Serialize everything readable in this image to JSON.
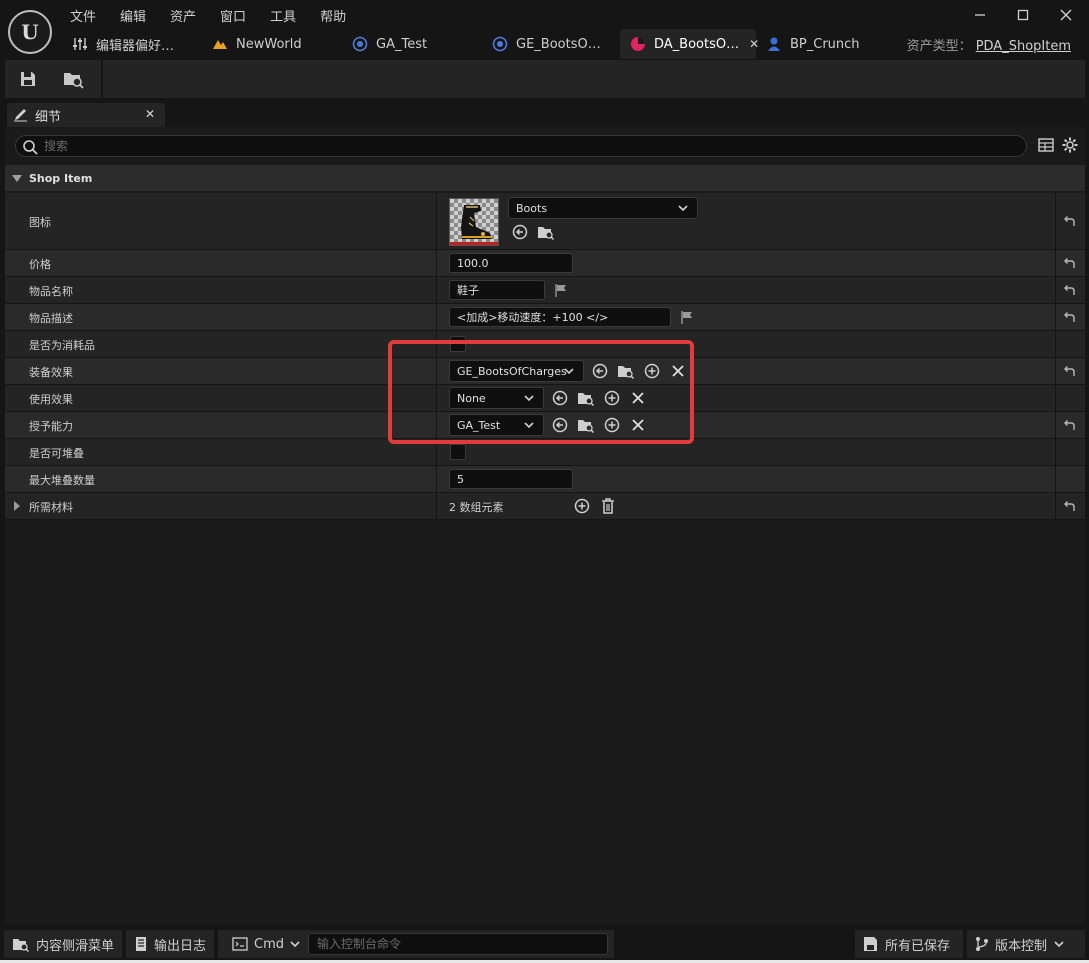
{
  "app": {
    "menu": [
      "文件",
      "编辑",
      "资产",
      "窗口",
      "工具",
      "帮助"
    ],
    "tabs": [
      {
        "label": "编辑器偏好…",
        "icon": "sliders-icon"
      },
      {
        "label": "NewWorld",
        "icon": "level-icon"
      },
      {
        "label": "GA_Test",
        "icon": "blueprint-icon"
      },
      {
        "label": "GE_BootsO…",
        "icon": "blueprint-icon"
      },
      {
        "label": "DA_BootsO…",
        "icon": "data-asset-icon",
        "active": true
      },
      {
        "label": "BP_Crunch",
        "icon": "character-icon"
      }
    ],
    "asset_type_label": "资产类型：",
    "asset_type_value": "PDA_ShopItem"
  },
  "details": {
    "tab_label": "细节",
    "search_placeholder": "搜索",
    "category": "Shop Item",
    "icon_row": {
      "label": "图标",
      "combo_value": "Boots"
    },
    "price": {
      "label": "价格",
      "value": "100.0"
    },
    "item_name": {
      "label": "物品名称",
      "value": "鞋子"
    },
    "item_desc": {
      "label": "物品描述",
      "value": "<加成>移动速度：+100 </>"
    },
    "consumable": {
      "label": "是否为消耗品",
      "checked": false
    },
    "equip_effect": {
      "label": "装备效果",
      "value": "GE_BootsOfCharges"
    },
    "use_effect": {
      "label": "使用效果",
      "value": "None"
    },
    "grant_ability": {
      "label": "授予能力",
      "value": "GA_Test"
    },
    "stackable": {
      "label": "是否可堆叠",
      "checked": false
    },
    "max_stack": {
      "label": "最大堆叠数量",
      "value": "5"
    },
    "materials": {
      "label": "所需材料",
      "value": "2 数组元素"
    }
  },
  "status": {
    "content_drawer": "内容侧滑菜单",
    "output_log": "输出日志",
    "cmd": "Cmd",
    "console_placeholder": "输入控制台命令",
    "all_saved": "所有已保存",
    "source_control": "版本控制"
  },
  "colors": {
    "highlight": "#e23b3b",
    "active_tab_icon": "#e0245e"
  }
}
